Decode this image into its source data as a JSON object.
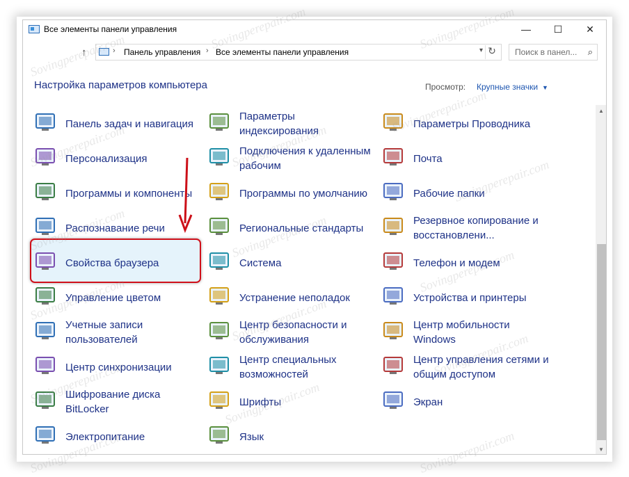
{
  "window": {
    "title": "Все элементы панели управления",
    "buttons": {
      "minimize": "—",
      "maximize": "☐",
      "close": "✕"
    }
  },
  "address": {
    "crumbs": [
      "Панель управления",
      "Все элементы панели управления"
    ],
    "separator": "›",
    "search_placeholder": "Поиск в панел..."
  },
  "header": {
    "title": "Настройка параметров компьютера",
    "view_label": "Просмотр:",
    "view_value": "Крупные значки"
  },
  "items": [
    {
      "label": "Панель задач и навигация",
      "icon": "taskbar-icon"
    },
    {
      "label": "Параметры индексирования",
      "icon": "indexing-icon"
    },
    {
      "label": "Параметры Проводника",
      "icon": "explorer-options-icon"
    },
    {
      "label": "Персонализация",
      "icon": "personalization-icon"
    },
    {
      "label": "Подключения к удаленным рабочим",
      "icon": "remote-desktop-icon"
    },
    {
      "label": "Почта",
      "icon": "mail-icon"
    },
    {
      "label": "Программы и компоненты",
      "icon": "programs-icon"
    },
    {
      "label": "Программы по умолчанию",
      "icon": "default-programs-icon"
    },
    {
      "label": "Рабочие папки",
      "icon": "work-folders-icon"
    },
    {
      "label": "Распознавание речи",
      "icon": "microphone-icon"
    },
    {
      "label": "Региональные стандарты",
      "icon": "region-icon"
    },
    {
      "label": "Резервное копирование и восстановлени...",
      "icon": "backup-icon"
    },
    {
      "label": "Свойства браузера",
      "icon": "internet-options-icon"
    },
    {
      "label": "Система",
      "icon": "system-icon"
    },
    {
      "label": "Телефон и модем",
      "icon": "phone-modem-icon"
    },
    {
      "label": "Управление цветом",
      "icon": "color-management-icon"
    },
    {
      "label": "Устранение неполадок",
      "icon": "troubleshooting-icon"
    },
    {
      "label": "Устройства и принтеры",
      "icon": "devices-printers-icon"
    },
    {
      "label": "Учетные записи пользователей",
      "icon": "user-accounts-icon"
    },
    {
      "label": "Центр безопасности и обслуживания",
      "icon": "security-center-icon"
    },
    {
      "label": "Центр мобильности Windows",
      "icon": "mobility-center-icon"
    },
    {
      "label": "Центр синхронизации",
      "icon": "sync-center-icon"
    },
    {
      "label": "Центр специальных возможностей",
      "icon": "ease-of-access-icon"
    },
    {
      "label": "Центр управления сетями и общим доступом",
      "icon": "network-center-icon"
    },
    {
      "label": "Шифрование диска BitLocker",
      "icon": "bitlocker-icon"
    },
    {
      "label": "Шрифты",
      "icon": "fonts-icon"
    },
    {
      "label": "Экран",
      "icon": "display-icon"
    },
    {
      "label": "Электропитание",
      "icon": "power-icon"
    },
    {
      "label": "Язык",
      "icon": "language-icon"
    }
  ],
  "selected_item": "Свойства браузера",
  "watermark": "Sovingperepair.com",
  "colors": {
    "link": "#1e3287",
    "selection_border": "#d0101a",
    "selection_fill": "#e5f3fb",
    "arrow": "#cc0f18"
  }
}
